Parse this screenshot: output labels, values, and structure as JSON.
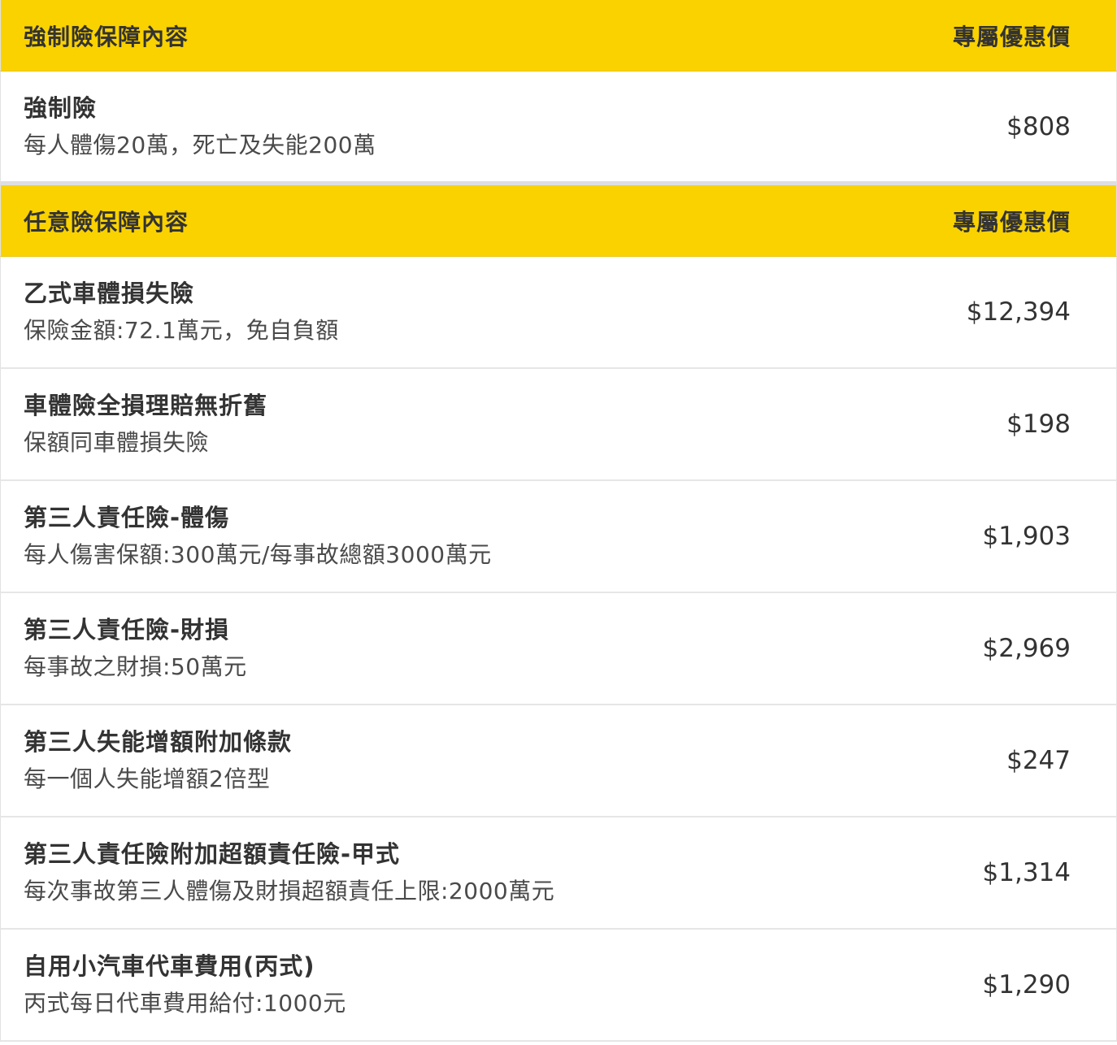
{
  "compulsory": {
    "header": {
      "title": "強制險保障內容",
      "price_label": "專屬優惠價"
    },
    "items": [
      {
        "name": "強制險",
        "desc": "每人體傷20萬，死亡及失能200萬",
        "price": "$808"
      }
    ]
  },
  "optional": {
    "header": {
      "title": "任意險保障內容",
      "price_label": "專屬優惠價"
    },
    "items": [
      {
        "name": "乙式車體損失險",
        "desc": "保險金額:72.1萬元，免自負額",
        "price": "$12,394"
      },
      {
        "name": "車體險全損理賠無折舊",
        "desc": "保額同車體損失險",
        "price": "$198"
      },
      {
        "name": "第三人責任險-體傷",
        "desc": "每人傷害保額:300萬元/每事故總額3000萬元",
        "price": "$1,903"
      },
      {
        "name": "第三人責任險-財損",
        "desc": "每事故之財損:50萬元",
        "price": "$2,969"
      },
      {
        "name": "第三人失能增額附加條款",
        "desc": "每一個人失能增額2倍型",
        "price": "$247"
      },
      {
        "name": "第三人責任險附加超額責任險-甲式",
        "desc": "每次事故第三人體傷及財損超額責任上限:2000萬元",
        "price": "$1,314"
      },
      {
        "name": "自用小汽車代車費用(丙式)",
        "desc": "丙式每日代車費用給付:1000元",
        "price": "$1,290"
      }
    ]
  },
  "colors": {
    "header_bg": "#fad200",
    "text": "#333333",
    "divider": "#e6e6e6"
  }
}
